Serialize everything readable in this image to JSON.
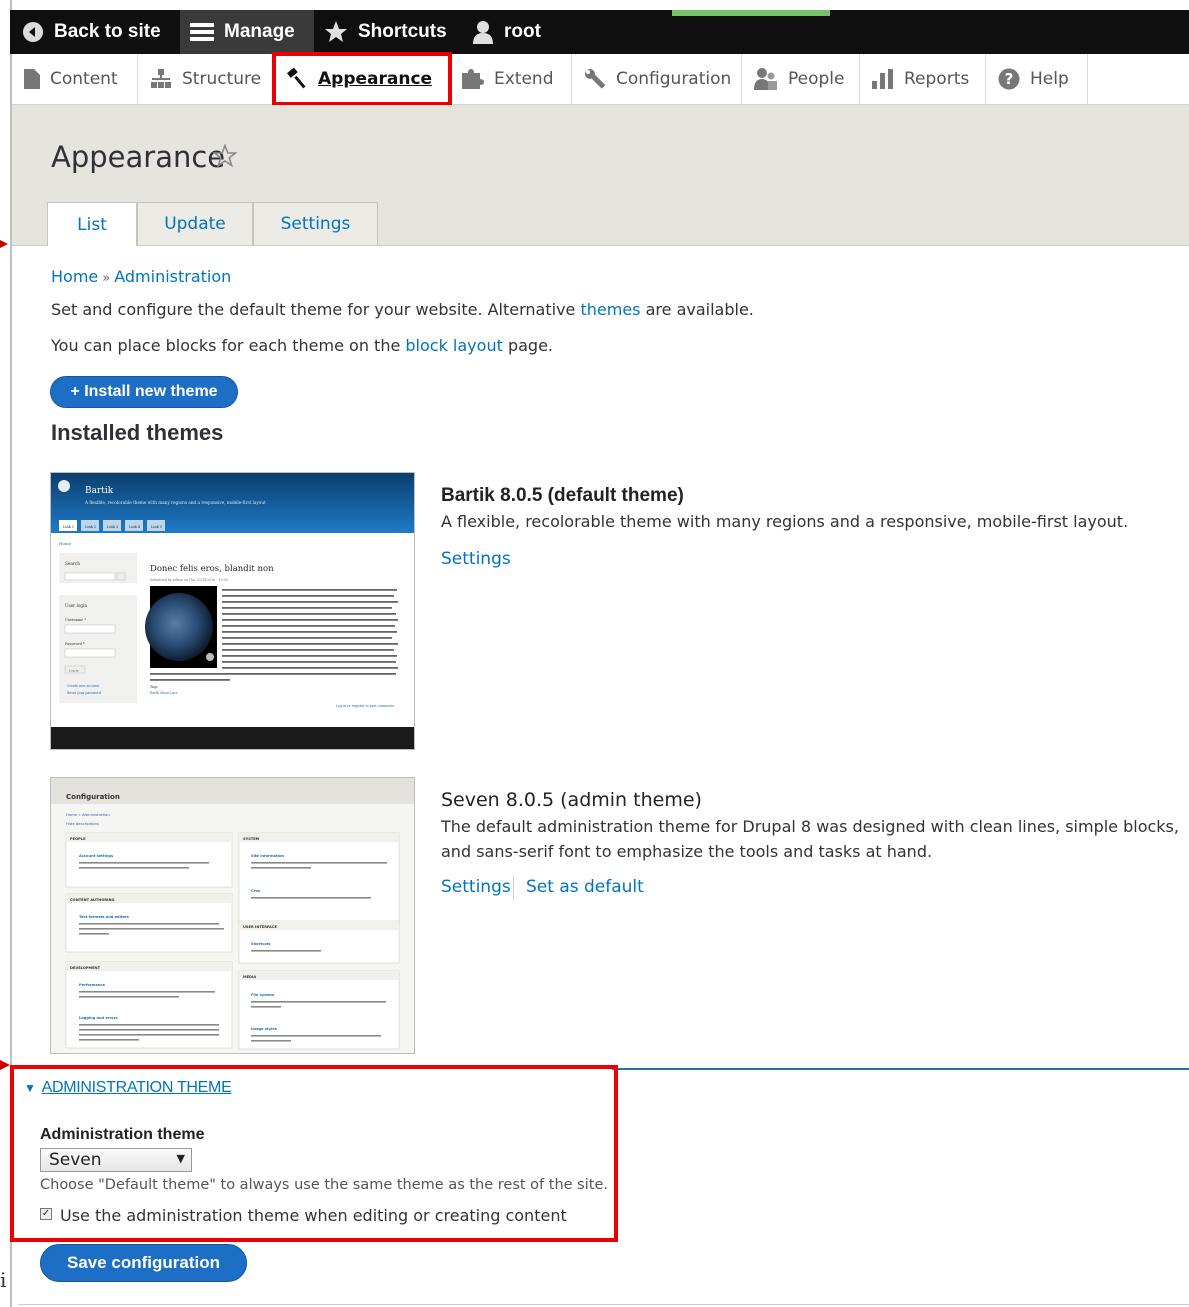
{
  "toolbar": {
    "back_label": "Back to site",
    "manage_label": "Manage",
    "shortcuts_label": "Shortcuts",
    "user_label": "root"
  },
  "tray": {
    "content": "Content",
    "structure": "Structure",
    "appearance": "Appearance",
    "extend": "Extend",
    "configuration": "Configuration",
    "people": "People",
    "reports": "Reports",
    "help": "Help"
  },
  "page": {
    "title": "Appearance",
    "tabs": [
      "List",
      "Update",
      "Settings"
    ],
    "breadcrumb": [
      "Home",
      "»",
      "Administration"
    ],
    "desc1_pre": "Set and configure the default theme for your website. Alternative ",
    "desc1_link": "themes",
    "desc1_post": " are available.",
    "desc2_pre": "You can place blocks for each theme on the ",
    "desc2_link": "block layout",
    "desc2_post": " page.",
    "install_button": "+ Install new theme",
    "installed_heading": "Installed themes"
  },
  "themes": [
    {
      "title": "Bartik 8.0.5 (default theme)",
      "description": "A flexible, recolorable theme with many regions and a responsive, mobile-first layout.",
      "links": [
        "Settings"
      ],
      "shot": {
        "site_name": "Bartik",
        "slogan": "A flexible, recolorable theme with many regions and a responsive, mobile-first layout",
        "tabs": [
          "Link 1",
          "Link 2",
          "Link 3",
          "Link 4",
          "Link 5"
        ],
        "home": "Home",
        "search": "Search",
        "login": "User login",
        "username": "Username *",
        "password": "Password *",
        "login_btn": "Log in",
        "create": "Create new account",
        "reset": "Reset your password",
        "article_title": "Donec felis eros, blandit non",
        "submitted": "Submitted by admin on Thu, 02/18/2016 - 19:26",
        "tags": "Tags",
        "tag_values": "Earth  Moon  Lars",
        "footer_link": "Log in or register to post comments"
      }
    },
    {
      "title": "Seven 8.0.5 (admin theme)",
      "description": "The default administration theme for Drupal 8 was designed with clean lines, simple blocks, and sans-serif font to emphasize the tools and tasks at hand.",
      "links": [
        "Settings",
        "Set as default"
      ],
      "shot": {
        "title": "Configuration",
        "breadcrumb": "Home » Administration",
        "hide": "Hide descriptions",
        "sections": {
          "people": "PEOPLE",
          "system": "SYSTEM",
          "content": "CONTENT AUTHORING",
          "ui": "USER INTERFACE",
          "dev": "DEVELOPMENT",
          "media": "MEDIA"
        },
        "items": {
          "account": "Account settings",
          "site_info": "Site information",
          "cron": "Cron",
          "text_formats": "Text formats and editors",
          "shortcuts": "Shortcuts",
          "performance": "Performance",
          "file_system": "File system",
          "logging": "Logging and errors",
          "image_styles": "Image styles"
        }
      }
    }
  ],
  "admin_theme": {
    "summary": "ADMINISTRATION THEME",
    "label": "Administration theme",
    "selected": "Seven",
    "help": "Choose \"Default theme\" to always use the same theme as the rest of the site.",
    "checkbox_label": "Use the administration theme when editing or creating content",
    "checkbox_checked": true
  },
  "save_button": "Save configuration",
  "stray_char": "i",
  "colors": {
    "link": "#0074bd",
    "button": "#1d6fc5",
    "highlight": "#ee0000",
    "toolbar": "#0f0f0f"
  }
}
